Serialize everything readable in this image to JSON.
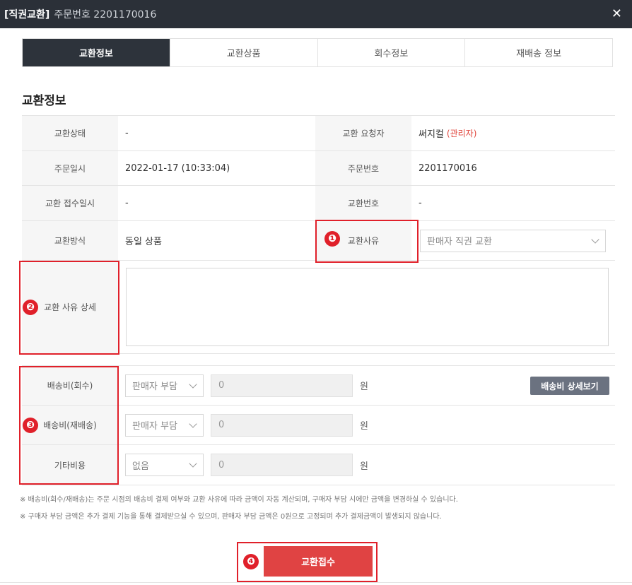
{
  "window": {
    "title_bracket": "[직권교환]",
    "title_order": "주문번호 2201170016"
  },
  "tabs": [
    {
      "label": "교환정보",
      "active": true
    },
    {
      "label": "교환상품",
      "active": false
    },
    {
      "label": "회수정보",
      "active": false
    },
    {
      "label": "재배송 정보",
      "active": false
    }
  ],
  "section_title": "교환정보",
  "info": {
    "status_label": "교환상태",
    "status_value": "-",
    "requester_label": "교환 요청자",
    "requester_value": "써지컬",
    "requester_role": "(관리자)",
    "order_date_label": "주문일시",
    "order_date_value": "2022-01-17 (10:33:04)",
    "order_no_label": "주문번호",
    "order_no_value": "2201170016",
    "receipt_label": "교환 접수일시",
    "receipt_value": "-",
    "exchange_no_label": "교환번호",
    "exchange_no_value": "-",
    "method_label": "교환방식",
    "method_value": "동일 상품",
    "reason_label": "교환사유",
    "reason_value": "판매자 직권 교환",
    "reason_detail_label": "교환 사유 상세"
  },
  "fees": {
    "return_label": "배송비(회수)",
    "return_payer": "판매자 부담",
    "return_amount": "0",
    "reship_label": "배송비(재배송)",
    "reship_payer": "판매자 부담",
    "reship_amount": "0",
    "other_label": "기타비용",
    "other_payer": "없음",
    "other_amount": "0",
    "unit": "원",
    "detail_button": "배송비 상세보기"
  },
  "notes": [
    "※ 배송비(회수/재배송)는 주문 시점의 배송비 결제 여부와 교환 사유에 따라 금액이 자동 계산되며, 구매자 부담 시에만 금액을 변경하실 수 있습니다.",
    "※ 구매자 부담 금액은 추가 결제 기능을 통해 결제받으실 수 있으며, 판매자 부담 금액은 0원으로 고정되며 추가 결제금액이 발생되지 않습니다."
  ],
  "submit_label": "교환접수",
  "annotations": [
    "❶",
    "❷",
    "❸",
    "❹"
  ],
  "colors": {
    "accent": "#e04343",
    "highlight": "#e0202a",
    "header": "#2b3038"
  }
}
